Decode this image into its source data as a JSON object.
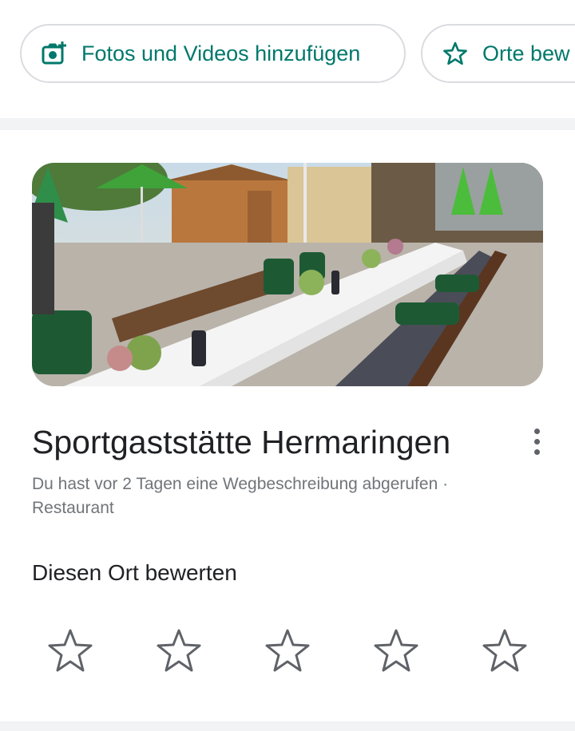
{
  "chips": [
    {
      "label": "Fotos und Videos hinzufügen",
      "icon": "add-photo-icon"
    },
    {
      "label": "Orte bew",
      "icon": "star-outline-icon"
    }
  ],
  "place": {
    "name": "Sportgaststätte Hermaringen",
    "subtitle": "Du hast vor 2 Tagen eine Wegbeschreibung abgerufen · Restaurant",
    "photo": "restaurant-terrace-photo"
  },
  "rating": {
    "title": "Diesen Ort bewerten",
    "stars": 5,
    "selected": 0
  },
  "colors": {
    "accent": "#00786b",
    "text": "#202124",
    "secondary": "#70757a",
    "divider": "#f1f3f4"
  }
}
